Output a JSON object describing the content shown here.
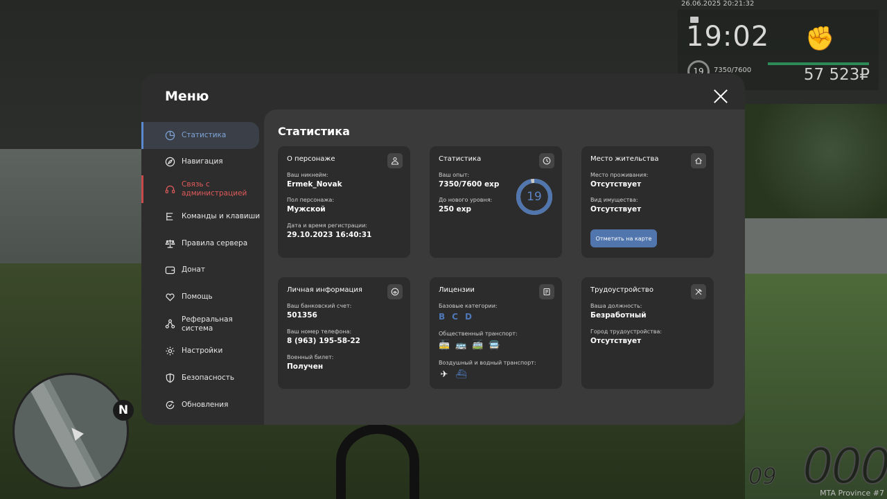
{
  "hud": {
    "datetime": "26.06.2025 20:21:32",
    "time": "19:02",
    "level": "19",
    "exp": "7350/7600",
    "money": "57 523₽",
    "server": "MTA Province #7",
    "speed": "000",
    "fuel": "09"
  },
  "minimap": {
    "north": "N"
  },
  "menu": {
    "title": "Меню",
    "sidebar": [
      {
        "label": "Статистика",
        "icon": "pie-chart-icon"
      },
      {
        "label": "Навигация",
        "icon": "compass-icon"
      },
      {
        "label": "Связь с администрацией",
        "icon": "headset-icon"
      },
      {
        "label": "Команды и клавиши",
        "icon": "list-icon"
      },
      {
        "label": "Правила сервера",
        "icon": "scales-icon"
      },
      {
        "label": "Донат",
        "icon": "wallet-icon"
      },
      {
        "label": "Помощь",
        "icon": "heart-hand-icon"
      },
      {
        "label": "Реферальная система",
        "icon": "network-icon"
      },
      {
        "label": "Настройки",
        "icon": "gear-icon"
      },
      {
        "label": "Безопасность",
        "icon": "shield-icon"
      },
      {
        "label": "Обновления",
        "icon": "refresh-icon"
      }
    ],
    "content_title": "Статистика",
    "cards": {
      "character": {
        "title": "О персонаже",
        "nickname_label": "Ваш никнейм:",
        "nickname": "Ermek_Novak",
        "gender_label": "Пол персонажа:",
        "gender": "Мужской",
        "reg_label": "Дата и время регистрации:",
        "reg": "29.10.2023 16:40:31"
      },
      "stats": {
        "title": "Статистика",
        "exp_label": "Ваш опыт:",
        "exp": "7350/7600 exp",
        "next_label": "До нового уровня:",
        "next": "250 exp",
        "level": "19",
        "progress": 0.967
      },
      "residence": {
        "title": "Место жительства",
        "place_label": "Место проживания:",
        "place": "Отсутствует",
        "property_label": "Вид имущества:",
        "property": "Отсутствует",
        "button": "Отметить на карте"
      },
      "personal": {
        "title": "Личная информация",
        "bank_label": "Ваш банковский счет:",
        "bank": "501356",
        "phone_label": "Ваш номер телефона:",
        "phone": "8 (963) 195-58-22",
        "military_label": "Военный билет:",
        "military": "Получен"
      },
      "licenses": {
        "title": "Лицензии",
        "basic_label": "Базовые категории:",
        "basic": [
          "B",
          "C",
          "D"
        ],
        "public_label": "Общественный транспорт:",
        "air_label": "Воздушный и водный транспорт:"
      },
      "employment": {
        "title": "Трудоустройство",
        "position_label": "Ваша должность:",
        "position": "Безработный",
        "city_label": "Город трудоустройства:",
        "city": "Отсутствует"
      }
    }
  },
  "colors": {
    "accent": "#5b85c4",
    "danger": "#e05a5a",
    "panel": "#2d2d2d",
    "card": "#2c2c2c"
  }
}
